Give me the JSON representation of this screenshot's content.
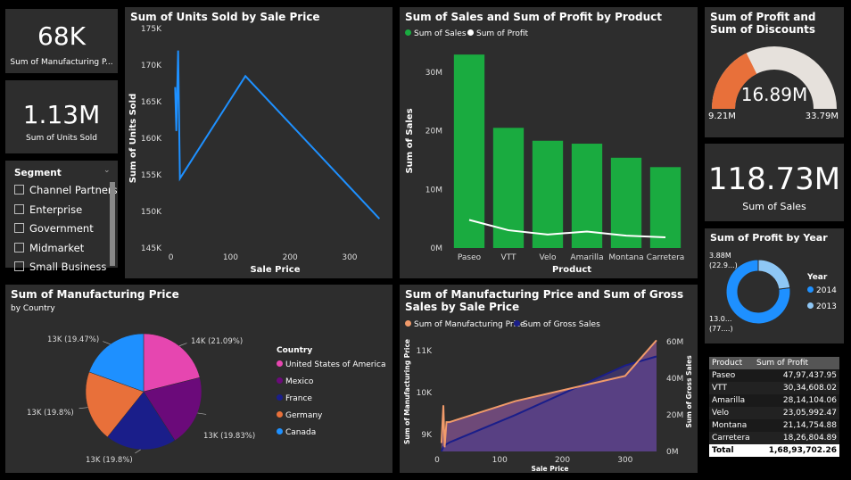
{
  "kpi_units_sold_card": {
    "value": "68K",
    "label": "Sum of Manufacturing P..."
  },
  "kpi_units_card": {
    "value": "1.13M",
    "label": "Sum of Units Sold"
  },
  "segment_slicer": {
    "title": "Segment",
    "items": [
      "Channel Partners",
      "Enterprise",
      "Government",
      "Midmarket",
      "Small Business"
    ]
  },
  "units_by_price": {
    "title": "Sum of Units Sold by Sale Price",
    "xlabel": "Sale Price",
    "ylabel": "Sum of Units Sold",
    "yticks": [
      "175K",
      "170K",
      "165K",
      "160K",
      "155K",
      "150K",
      "145K"
    ],
    "xticks": [
      "0",
      "100",
      "200",
      "300"
    ]
  },
  "sales_profit_by_product": {
    "title": "Sum of Sales and Sum of Profit by Product",
    "legend": [
      "Sum of  Sales",
      "Sum of Profit"
    ],
    "ylabel": "Sum of Sales",
    "xlabel": "Product",
    "yticks": [
      "30M",
      "20M",
      "10M",
      "0M"
    ]
  },
  "gauge": {
    "title": "Sum of Profit and Sum of Discounts",
    "value": "16.89M",
    "min": "9.21M",
    "max": "33.79M"
  },
  "sales_card": {
    "value": "118.73M",
    "label": "Sum of  Sales"
  },
  "profit_by_year": {
    "title": "Sum of Profit by Year",
    "legend_title": "Year",
    "label_top": "3.88M\n(22.9...)",
    "label_bottom": "13.0...\n(77....)",
    "years": [
      "2014",
      "2013"
    ]
  },
  "mfg_by_country": {
    "title": "Sum of Manufacturing Price",
    "subtitle": "by Country",
    "legend_title": "Country",
    "labels": [
      "14K (21.09%)",
      "13K (19.83%)",
      "13K (19.8%)",
      "13K (19.8%)",
      "13K (19.47%)"
    ]
  },
  "mfg_gross_by_price": {
    "title": "Sum of Manufacturing Price and Sum of Gross Sales by Sale Price",
    "legend": [
      "Sum of Manufacturing Price",
      "Sum of Gross Sales"
    ],
    "ylabel_left": "Sum of Manufacturing Price",
    "ylabel_right": "Sum of Gross Sales",
    "xlabel": "Sale Price",
    "yticks_left": [
      "11K",
      "10K",
      "9K"
    ],
    "yticks_right": [
      "60M",
      "40M",
      "20M",
      "0M"
    ],
    "xticks": [
      "0",
      "100",
      "200",
      "300"
    ]
  },
  "profit_table": {
    "headers": [
      "Product",
      "Sum of Profit"
    ],
    "rows": [
      {
        "product": "Paseo",
        "profit": "47,97,437.95"
      },
      {
        "product": "VTT",
        "profit": "30,34,608.02"
      },
      {
        "product": "Amarilla",
        "profit": "28,14,104.06"
      },
      {
        "product": "Velo",
        "profit": "23,05,992.47"
      },
      {
        "product": "Montana",
        "profit": "21,14,754.88"
      },
      {
        "product": "Carretera",
        "profit": "18,26,804.89"
      }
    ],
    "total_label": "Total",
    "total_value": "1,68,93,702.26"
  },
  "colors": {
    "tile_bg": "#2d2d2d",
    "blue": "#1e90ff",
    "green": "#1aab40",
    "orange": "#e8703a",
    "gauge_track": "#e6e1dc",
    "pink": "#e646b0",
    "purple": "#6b0a7a",
    "navy": "#1a1e8a",
    "light_blue": "#8ec7f5",
    "salmon": "#f09a6a"
  },
  "chart_data": [
    {
      "type": "line",
      "title": "Sum of Units Sold by Sale Price",
      "xlabel": "Sale Price",
      "ylabel": "Sum of Units Sold",
      "x": [
        7,
        9,
        10,
        12,
        15,
        125,
        350
      ],
      "y": [
        167000,
        161000,
        165000,
        172000,
        154500,
        168500,
        149000
      ],
      "xlim": [
        -10,
        360
      ],
      "ylim": [
        145000,
        175000
      ]
    },
    {
      "type": "bar",
      "title": "Sum of Sales and Sum of Profit by Product",
      "categories": [
        "Paseo",
        "VTT",
        "Velo",
        "Amarilla",
        "Montana",
        "Carretera"
      ],
      "series": [
        {
          "name": "Sum of  Sales",
          "values": [
            33000000,
            20500000,
            18300000,
            17800000,
            15400000,
            13800000
          ]
        },
        {
          "name": "Sum of Profit",
          "values": [
            4797437.95,
            3034608.02,
            2305992.47,
            2814104.06,
            2114754.88,
            1826804.89
          ]
        }
      ],
      "ylim": [
        0,
        35000000
      ]
    },
    {
      "type": "pie",
      "title": "Sum of Manufacturing Price",
      "categories": [
        "United States of America",
        "Mexico",
        "France",
        "Germany",
        "Canada"
      ],
      "values": [
        14000,
        13000,
        13000,
        13000,
        13000
      ],
      "percents": [
        21.09,
        19.83,
        19.8,
        19.8,
        19.47
      ]
    },
    {
      "type": "pie",
      "title": "Sum of Profit by Year",
      "categories": [
        "2014",
        "2013"
      ],
      "values": [
        13000000,
        3880000
      ]
    },
    {
      "type": "area",
      "title": "Sum of Manufacturing Price and Sum of Gross Sales by Sale Price",
      "x": [
        7,
        10,
        12,
        15,
        20,
        125,
        300,
        350
      ],
      "series": [
        {
          "name": "Sum of Manufacturing Price",
          "values": [
            8800,
            9700,
            8700,
            9300,
            9300,
            9800,
            10400,
            11250
          ]
        },
        {
          "name": "Sum of Gross Sales",
          "values": [
            0,
            2500000,
            3000000,
            4000000,
            5000000,
            20000000,
            47000000,
            52000000
          ]
        }
      ],
      "xlim": [
        0,
        360
      ],
      "ylim_left": [
        8600,
        11300
      ],
      "ylim_right": [
        0,
        62000000
      ]
    }
  ]
}
